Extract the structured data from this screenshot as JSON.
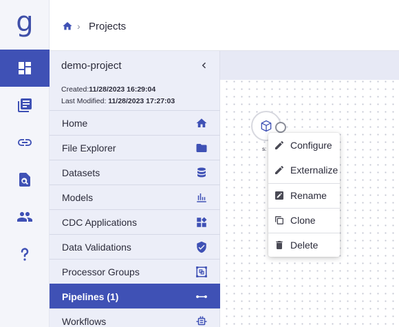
{
  "app": {
    "logo_letter": "g",
    "rail_icons": [
      "dashboard-icon",
      "library-books-icon",
      "link-icon",
      "document-search-icon",
      "people-icon",
      "help-icon"
    ],
    "accent_color": "#3f51b5"
  },
  "breadcrumb": {
    "items": [
      "Projects"
    ]
  },
  "project": {
    "name": "demo-project",
    "created_label": "Created:",
    "created_value": "11/28/2023 16:29:04",
    "modified_label": "Last Modified:",
    "modified_value": "11/28/2023 17:27:03"
  },
  "nav": {
    "items": [
      {
        "label": "Home",
        "icon": "home-icon"
      },
      {
        "label": "File Explorer",
        "icon": "folder-icon"
      },
      {
        "label": "Datasets",
        "icon": "database-icon"
      },
      {
        "label": "Models",
        "icon": "bar-chart-icon"
      },
      {
        "label": "CDC Applications",
        "icon": "widgets-icon"
      },
      {
        "label": "Data Validations",
        "icon": "verified-shield-icon"
      },
      {
        "label": "Processor Groups",
        "icon": "group-nodes-icon"
      },
      {
        "label": "Pipelines  (1)",
        "icon": "pipeline-connector-icon",
        "active": true
      },
      {
        "label": "Workflows",
        "icon": "workflow-icon"
      }
    ]
  },
  "canvas": {
    "node_label": "s:",
    "context_menu": [
      {
        "label": "Configure",
        "icon": "pencil-icon"
      },
      {
        "label": "Externalize",
        "icon": "pencil-icon"
      },
      {
        "label": "Rename",
        "icon": "rename-icon"
      },
      {
        "label": "Clone",
        "icon": "clone-icon"
      },
      {
        "label": "Delete",
        "icon": "trash-icon"
      }
    ]
  }
}
